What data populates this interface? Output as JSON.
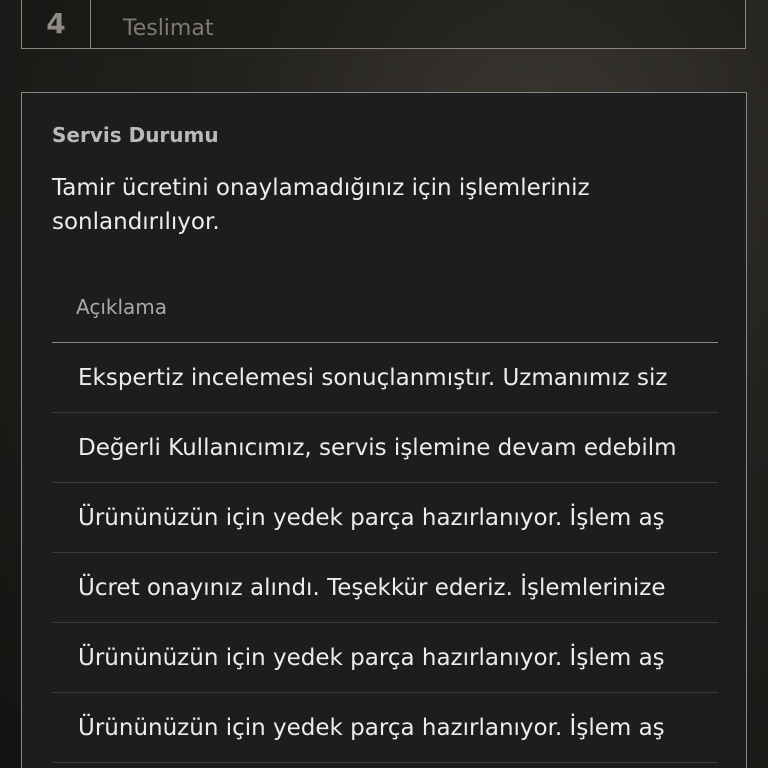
{
  "step": {
    "number": "4",
    "label": "Teslimat"
  },
  "service_status": {
    "title": "Servis Durumu",
    "message": "Tamir ücretini onaylamadığınız için işlemleriniz sonlandırılıyor."
  },
  "table": {
    "header": "Açıklama",
    "rows": [
      "Ekspertiz incelemesi sonuçlanmıştır. Uzmanımız siz",
      "Değerli Kullanıcımız, servis işlemine devam edebilm",
      "Ürününüzün için yedek parça hazırlanıyor. İşlem aş",
      "Ücret onayınız alındı. Teşekkür ederiz. İşlemlerinize",
      "Ürününüzün için yedek parça hazırlanıyor. İşlem aş",
      "Ürününüzün için yedek parça hazırlanıyor. İşlem aş"
    ]
  }
}
